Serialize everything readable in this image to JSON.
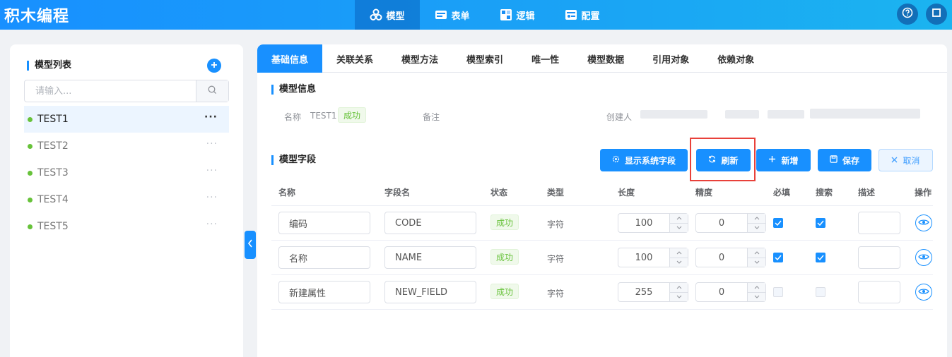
{
  "app": {
    "title": "积木编程"
  },
  "topnav": [
    {
      "label": "模型",
      "icon": "cubes-icon",
      "active": true
    },
    {
      "label": "表单",
      "icon": "form-icon",
      "active": false
    },
    {
      "label": "逻辑",
      "icon": "logic-icon",
      "active": false
    },
    {
      "label": "配置",
      "icon": "config-icon",
      "active": false
    }
  ],
  "sidebar": {
    "title": "模型列表",
    "search_placeholder": "请输入...",
    "items": [
      {
        "name": "TEST1",
        "active": true
      },
      {
        "name": "TEST2",
        "active": false
      },
      {
        "name": "TEST3",
        "active": false
      },
      {
        "name": "TEST4",
        "active": false
      },
      {
        "name": "TEST5",
        "active": false
      }
    ],
    "more": "···"
  },
  "tabs": [
    "基础信息",
    "关联关系",
    "模型方法",
    "模型索引",
    "唯一性",
    "模型数据",
    "引用对象",
    "依赖对象"
  ],
  "model_info": {
    "title": "模型信息",
    "name_label": "名称",
    "name_value": "TEST1",
    "status": "成功",
    "remark_label": "备注",
    "creator_label": "创建人"
  },
  "fields": {
    "title": "模型字段",
    "buttons": {
      "show_system": "显示系统字段",
      "refresh": "刷新",
      "add": "新增",
      "save": "保存",
      "cancel": "取消"
    },
    "headers": {
      "name": "名称",
      "field_name": "字段名",
      "status": "状态",
      "type": "类型",
      "length": "长度",
      "precision": "精度",
      "required": "必填",
      "search": "搜索",
      "description": "描述",
      "action": "操作"
    },
    "rows": [
      {
        "name": "编码",
        "field_name": "CODE",
        "status": "成功",
        "type": "字符",
        "length": "100",
        "precision": "0",
        "required": true,
        "search": true,
        "description": ""
      },
      {
        "name": "名称",
        "field_name": "NAME",
        "status": "成功",
        "type": "字符",
        "length": "100",
        "precision": "0",
        "required": true,
        "search": true,
        "description": ""
      },
      {
        "name": "新建属性",
        "field_name": "NEW_FIELD",
        "status": "成功",
        "type": "字符",
        "length": "255",
        "precision": "0",
        "required": false,
        "search": false,
        "description": ""
      }
    ]
  },
  "colors": {
    "primary": "#1890ff",
    "success": "#67c23a",
    "highlight": "#e8413a"
  }
}
